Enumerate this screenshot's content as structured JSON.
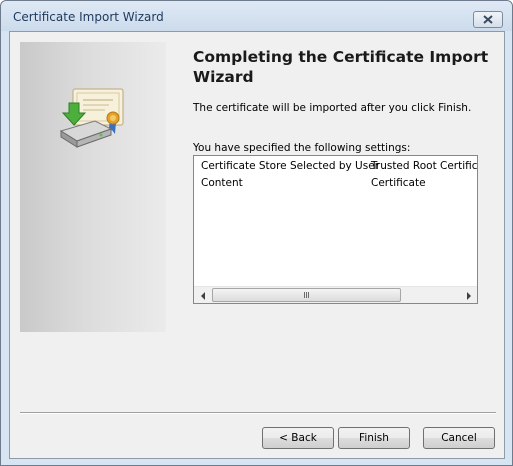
{
  "window": {
    "title": "Certificate Import Wizard",
    "close_icon": "close-x-icon"
  },
  "side_panel": {
    "icon": "certificate-import-icon"
  },
  "main": {
    "heading": "Completing the Certificate Import Wizard",
    "info": "The certificate will be imported after you click Finish.",
    "settings_label": "You have specified the following settings:",
    "settings": [
      {
        "name": "Certificate Store Selected by User",
        "value": "Trusted Root Certifica"
      },
      {
        "name": "Content",
        "value": "Certificate"
      }
    ],
    "scrollbar": {
      "left_icon": "scroll-left-arrow-icon",
      "right_icon": "scroll-right-arrow-icon"
    }
  },
  "buttons": {
    "back": "< Back",
    "finish": "Finish",
    "cancel": "Cancel"
  }
}
